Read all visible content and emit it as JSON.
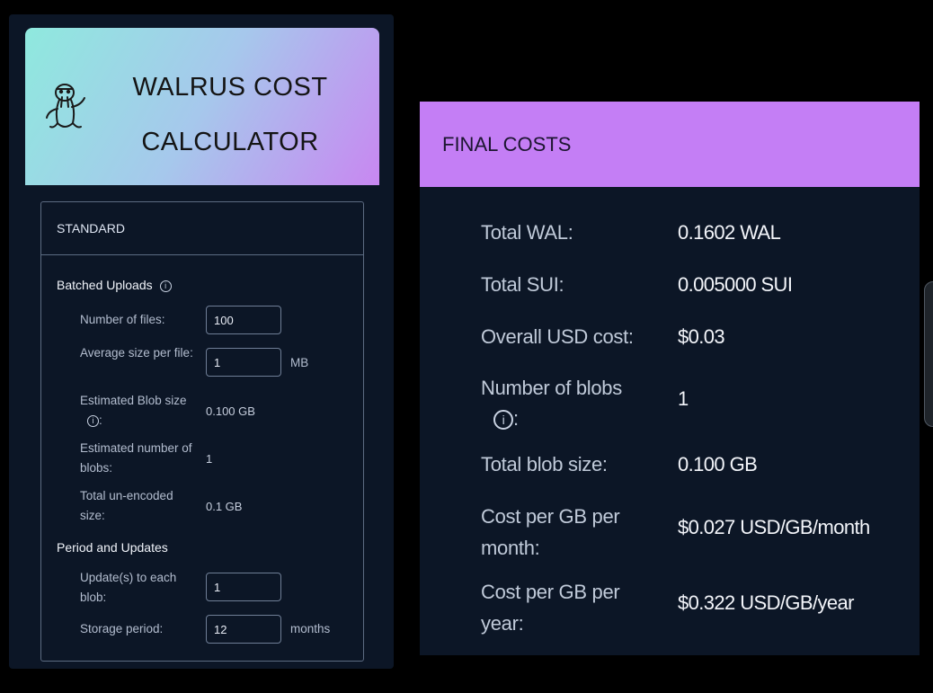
{
  "header": {
    "title_line1": "WALRUS COST",
    "title_line2": "CALCULATOR",
    "logo_icon": "walrus-icon"
  },
  "mode": {
    "label": "STANDARD"
  },
  "batched": {
    "title": "Batched Uploads",
    "num_files_label": "Number of files:",
    "num_files_value": "100",
    "avg_size_label": "Average size per file:",
    "avg_size_value": "1",
    "avg_size_unit": "MB",
    "est_blob_size_label": "Estimated Blob size",
    "est_blob_size_colon": ":",
    "est_blob_size_value": "0.100 GB",
    "est_num_blobs_label": "Estimated number of blobs:",
    "est_num_blobs_value": "1",
    "total_unencoded_label": "Total un-encoded size:",
    "total_unencoded_value": "0.1 GB"
  },
  "period": {
    "title": "Period and Updates",
    "updates_label": "Update(s) to each blob:",
    "updates_value": "1",
    "storage_label": "Storage period:",
    "storage_value": "12",
    "storage_unit": "months"
  },
  "final": {
    "title": "FINAL COSTS",
    "rows": [
      {
        "label": "Total WAL:",
        "value": "0.1602 WAL"
      },
      {
        "label": "Total SUI:",
        "value": "0.005000 SUI"
      },
      {
        "label": "Overall USD cost:",
        "value": "$0.03"
      },
      {
        "label": "Number of blobs",
        "label2": ":",
        "value": "1"
      },
      {
        "label": "Total blob size:",
        "value": "0.100 GB"
      },
      {
        "label": "Cost per GB per",
        "label2": "month:",
        "value": "$0.027 USD/GB/month"
      },
      {
        "label": "Cost per GB per",
        "label2": "year:",
        "value": "$0.322 USD/GB/year"
      }
    ]
  },
  "colors": {
    "accent_purple": "#c47ef5",
    "gradient_mint": "#8fe9de",
    "panel_bg": "#0c1626"
  }
}
